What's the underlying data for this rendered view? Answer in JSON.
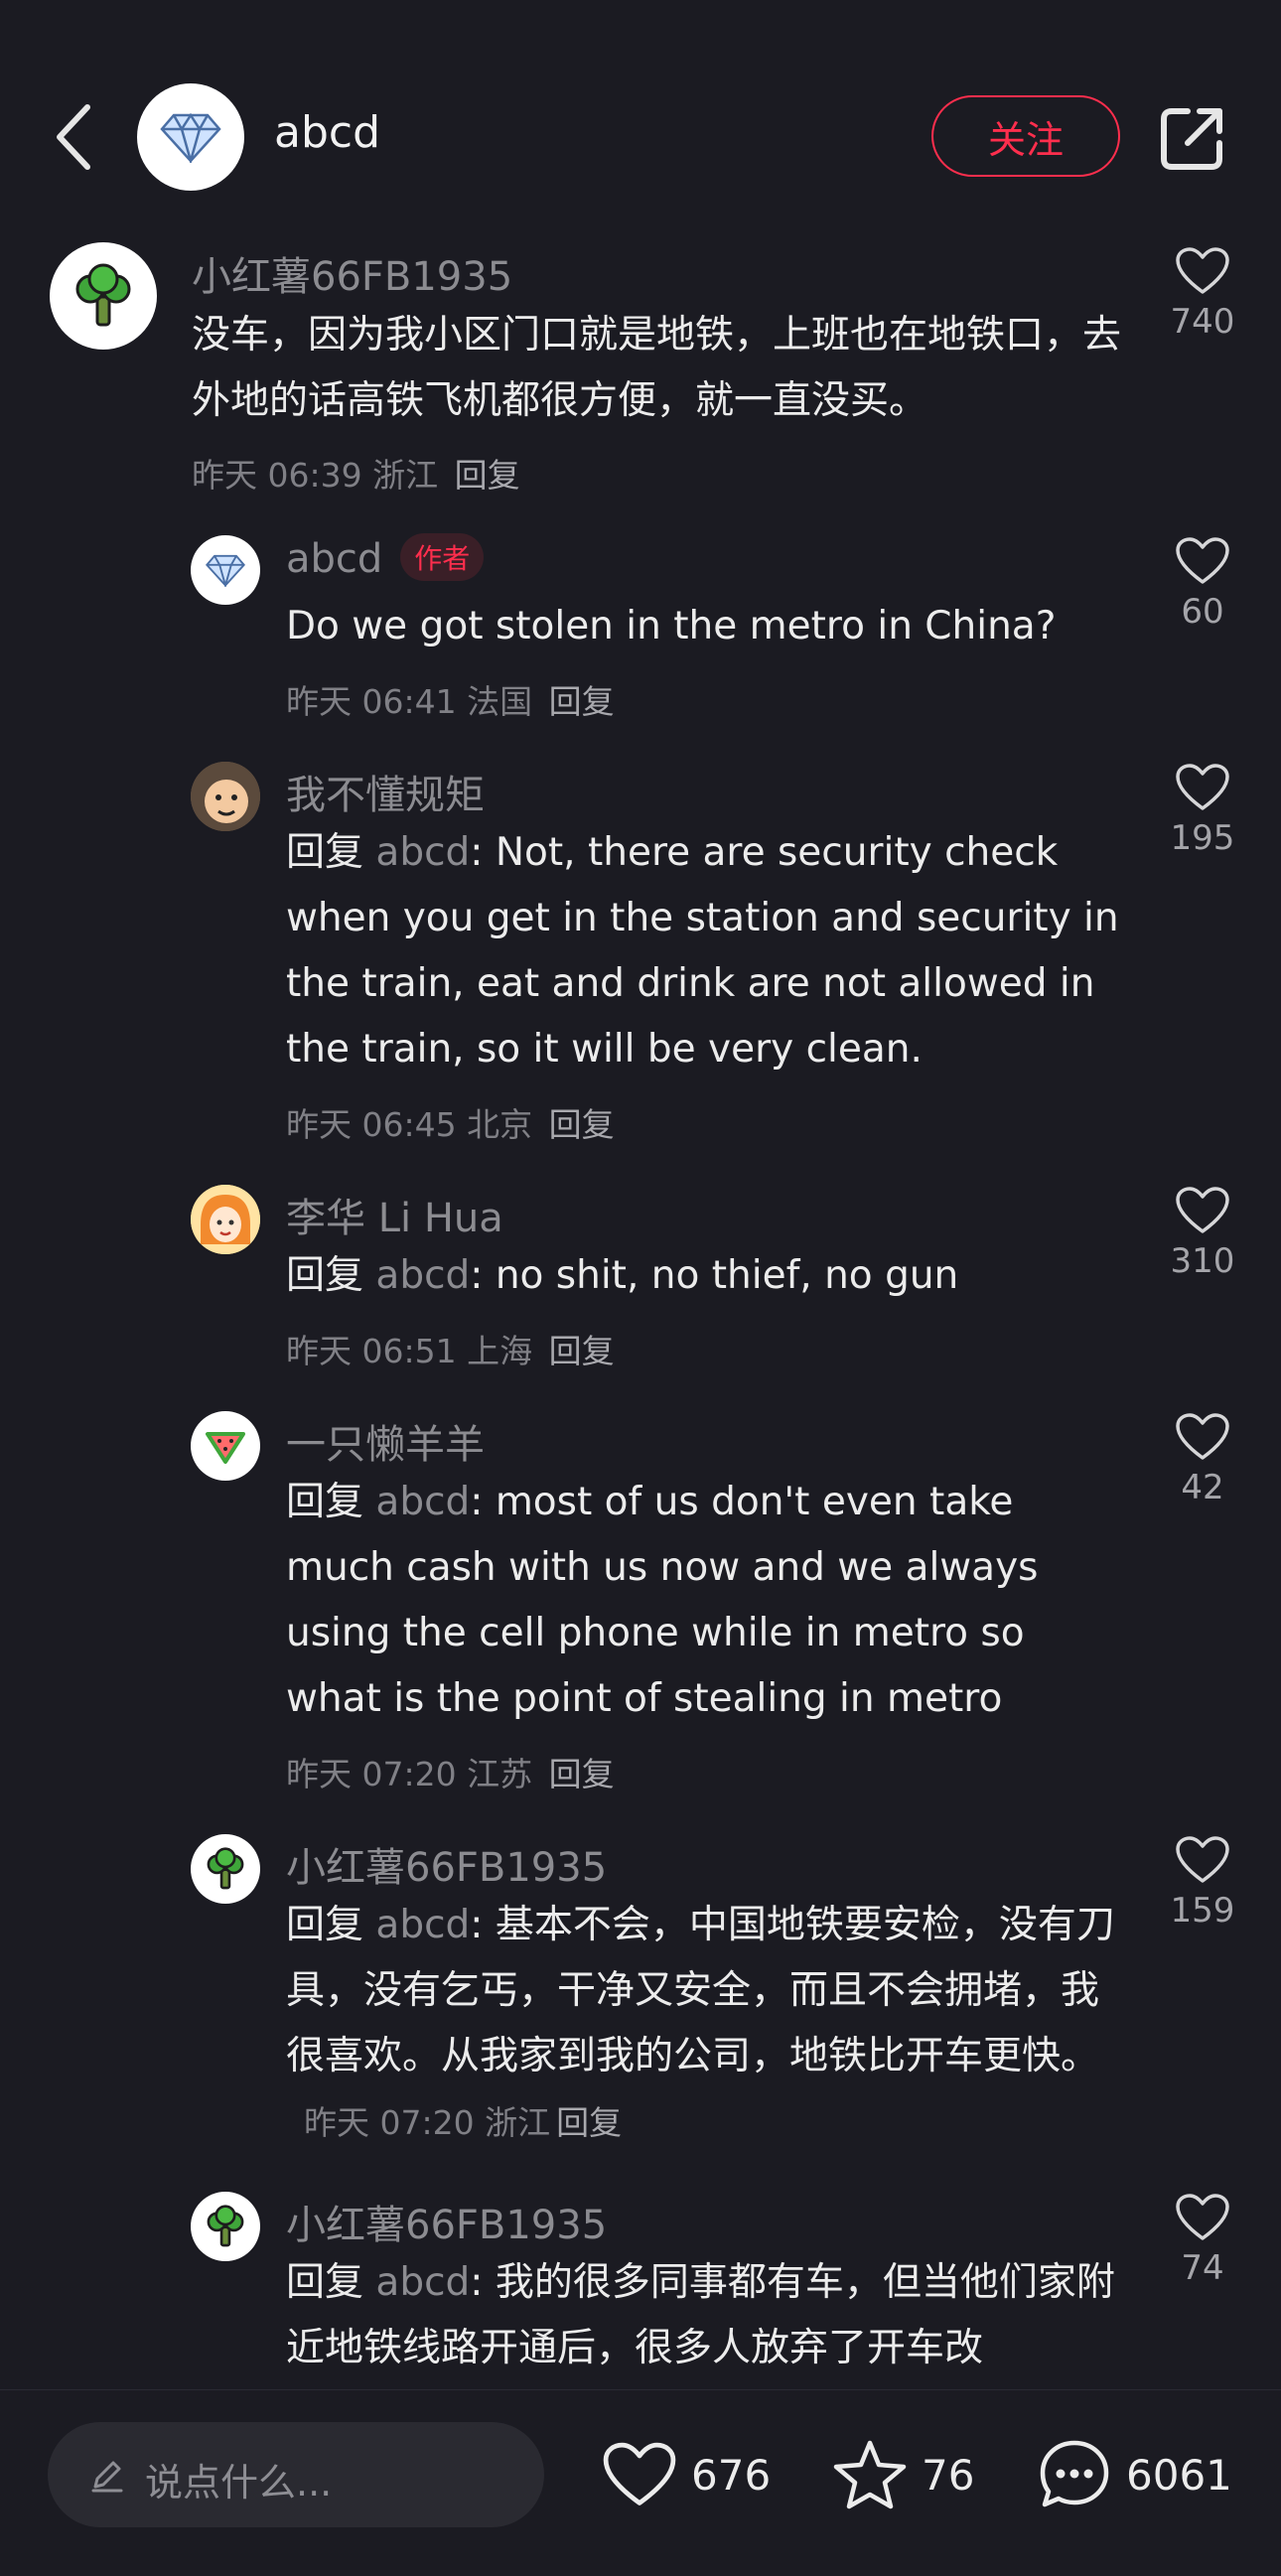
{
  "header": {
    "name": "abcd",
    "follow_label": "关注"
  },
  "comments": [
    {
      "author": "小红薯66FB1935",
      "text": "没车，因为我小区门口就是地铁，上班也在地铁口，去外地的话高铁飞机都很方便，就一直没买。",
      "time": "昨天 06:39 浙江",
      "reply_label": "回复",
      "likes": "740",
      "avatar_icon": "broccoli-icon"
    }
  ],
  "replies": [
    {
      "author": "abcd",
      "tag": "作者",
      "reply_prefix": "",
      "mention": "",
      "text": "Do we got stolen in the metro in China?",
      "time": "昨天 06:41 法国",
      "reply_label": "回复",
      "likes": "60",
      "avatar_icon": "diamond-icon"
    },
    {
      "author": "我不懂规矩",
      "reply_prefix": "回复",
      "mention": "abcd",
      "text": ": Not, there are security check when you get in the station and security in the train, eat and drink  are not allowed in the train, so it will be very clean.",
      "time": "昨天 06:45 北京",
      "reply_label": "回复",
      "likes": "195",
      "avatar_icon": "cartoon-face-icon"
    },
    {
      "author": "李华 Li Hua",
      "reply_prefix": "回复",
      "mention": "abcd",
      "text": ": no shit, no thief, no gun",
      "time": "昨天 06:51 上海",
      "reply_label": "回复",
      "likes": "310",
      "avatar_icon": "girl-avatar-icon"
    },
    {
      "author": "一只懒羊羊",
      "reply_prefix": "回复",
      "mention": "abcd",
      "text": ": most of us don't even take much cash with us now and we always using the cell phone while in metro so what is the point of stealing in metro",
      "time": "昨天 07:20 江苏",
      "reply_label": "回复",
      "likes": "42",
      "avatar_icon": "watermelon-icon"
    },
    {
      "author": "小红薯66FB1935",
      "reply_prefix": "回复",
      "mention": "abcd",
      "text": ": 基本不会，中国地铁要安检，没有刀具，没有乞丐，干净又安全，而且不会拥堵，我很喜欢。从我家到我的公司，地铁比开车更快。",
      "time": "昨天 07:20 浙江",
      "reply_label": "回复",
      "likes": "159",
      "avatar_icon": "broccoli-icon"
    },
    {
      "author": "小红薯66FB1935",
      "reply_prefix": "回复",
      "mention": "abcd",
      "text": ": 我的很多同事都有车，但当他们家附近地铁线路开通后，很多人放弃了开车改",
      "time": "",
      "reply_label": "",
      "likes": "74",
      "avatar_icon": "broccoli-icon"
    }
  ],
  "bottom_bar": {
    "input_placeholder": "说点什么...",
    "like_count": "676",
    "star_count": "76",
    "comment_count": "6061"
  },
  "colors": {
    "background": "#1b1b22",
    "accent_red": "#ff2e4d",
    "muted_text": "#8c8c91"
  }
}
